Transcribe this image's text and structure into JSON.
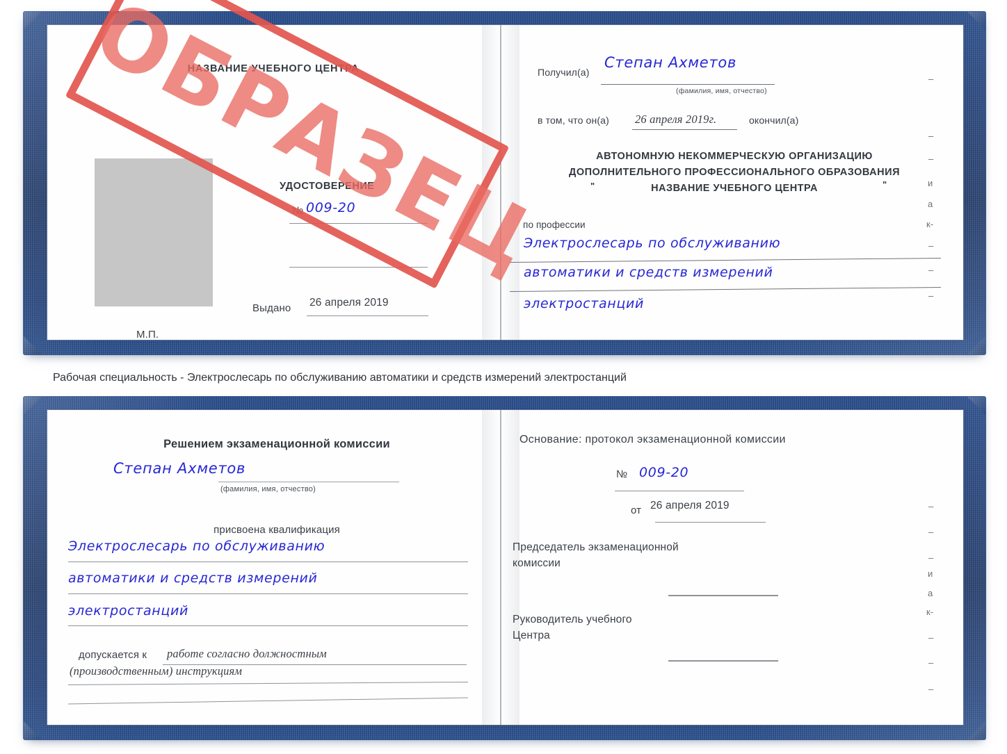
{
  "caption": {
    "text": "Рабочая специальность - Электрослесарь по обслуживанию автоматики и средств измерений электростанций"
  },
  "certificate_top": {
    "page_left": {
      "center_title": "НАЗВАНИЕ УЧЕБНОГО ЦЕНТРА",
      "doc_type": "УДОСТОВЕРЕНИЕ",
      "number_label": "№",
      "number_value": "009-20",
      "issued_label": "Выдано",
      "issued_value": "26 апреля 2019",
      "seal_label": "М.П.",
      "photo_placeholder": ""
    },
    "page_right": {
      "received_label": "Получил(а)",
      "received_value": "Степан Ахметов",
      "received_hint": "(фамилия, имя, отчество)",
      "in_that_label": "в том, что он(а)",
      "in_that_value": "26 апреля 2019г.",
      "finished_label": "окончил(а)",
      "org_line1": "АВТОНОМНУЮ НЕКОММЕРЧЕСКУЮ ОРГАНИЗАЦИЮ",
      "org_line2": "ДОПОЛНИТЕЛЬНОГО ПРОФЕССИОНАЛЬНОГО ОБРАЗОВАНИЯ",
      "org_quote_open": "\"",
      "org_line3": "НАЗВАНИЕ УЧЕБНОГО ЦЕНТРА",
      "org_quote_close": "\"",
      "profession_label": "по профессии",
      "profession_line1": "Электрослесарь по обслуживанию",
      "profession_line2": "автоматики и средств измерений",
      "profession_line3": "электростанций",
      "edge_bleed": [
        "–",
        "–",
        "–",
        "и",
        "а",
        "к-",
        "–",
        "–",
        "–"
      ]
    },
    "stamp": {
      "text": "ОБРАЗЕЦ",
      "color": "#e2564e"
    }
  },
  "certificate_bottom": {
    "page_left": {
      "title": "Решением экзаменационной комиссии",
      "name_value": "Степан Ахметов",
      "name_hint": "(фамилия, имя, отчество)",
      "qualification_label": "присвоена квалификация",
      "qualification_line1": "Электрослесарь по обслуживанию",
      "qualification_line2": "автоматики и средств измерений",
      "qualification_line3": "электростанций",
      "admitted_label": "допускается к",
      "admitted_value1": "работе согласно должностным",
      "admitted_value2": "(производственным) инструкциям"
    },
    "page_right": {
      "basis_label": "Основание: протокол экзаменационной комиссии",
      "protocol_number_label": "№",
      "protocol_number_value": "009-20",
      "protocol_date_label": "от",
      "protocol_date_value": "26 апреля 2019",
      "chairman_line1": "Председатель экзаменационной",
      "chairman_line2": "комиссии",
      "head_line1": "Руководитель учебного",
      "head_line2": "Центра",
      "edge_bleed": [
        "–",
        "–",
        "–",
        "и",
        "а",
        "к-",
        "–",
        "–",
        "–"
      ]
    }
  },
  "colors": {
    "cover_blue": "#24437c",
    "ink_blue": "#2727d4",
    "stamp_red": "#e2564e",
    "photo_grey": "#c6c6c6"
  }
}
